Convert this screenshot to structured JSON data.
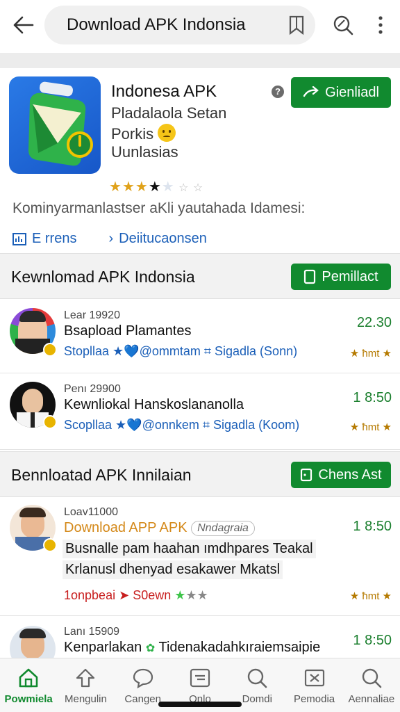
{
  "search": {
    "query": "Download APK Indonsia"
  },
  "app": {
    "title": "Indonesa APK",
    "line1": "Pladalaola Setan",
    "line2": "Porkis",
    "line3": "Uunlasias",
    "button_label": "Gienliadl",
    "help": "?",
    "rating": 3.5,
    "description": "Kominyarmanlastser aKli yautahada Idamesi:",
    "link1": "E rrens",
    "link2": "Deiitucaonsen"
  },
  "section1": {
    "title": "Kewnlomad APK Indonsia",
    "button_label": "Pemillact",
    "items": [
      {
        "meta": "Lear 19920",
        "name": "Bsapload Plamantes",
        "sub": "Stopllaa ★💙@ommtam ⌗ Sigadla (Sonn)",
        "time": "22.30",
        "rate": "★ ћmt ★"
      },
      {
        "meta": "Penı 29900",
        "name": "Kewnliokal Hanskoslananolla",
        "sub": "Scopllaa ★💙@onnkem ⌗ Sigadla (Koom)",
        "time": "1 8:50",
        "rate": "★ ћmt ★"
      }
    ]
  },
  "section2": {
    "title": "Bennloatad APK Innilaian",
    "button_label": "Chens Ast",
    "items": [
      {
        "meta": "Loav11000",
        "name": "Download APP APK",
        "tag": "Nndagraia",
        "hl1": "Busnalle pam haahan ımdhpares Teakal",
        "hl2": "Krlanusl dhenyad esakawer Mkatsl",
        "sub_red": "1onpbeai",
        "sub_red2": "S0ewn",
        "time": "1 8:50",
        "rate": "★ ћmt ★"
      },
      {
        "meta": "Lanı 15909",
        "name": "Kenparlakan",
        "name2": "Tidenakadahkıraiemsaipie",
        "time": "1 8:50"
      }
    ]
  },
  "nav": [
    {
      "label": "Powmiela",
      "icon": "home-icon",
      "active": true
    },
    {
      "label": "Mengulin",
      "icon": "upload-icon"
    },
    {
      "label": "Cangen",
      "icon": "chat-icon"
    },
    {
      "label": "Onlo",
      "icon": "note-icon"
    },
    {
      "label": "Domdi",
      "icon": "search-heart-icon"
    },
    {
      "label": "Pemodia",
      "icon": "mail-icon"
    },
    {
      "label": "Aennaliae",
      "icon": "search-icon"
    }
  ],
  "colors": {
    "accent": "#118a2f",
    "link": "#1b5fb8",
    "time": "#1b7f2e"
  }
}
